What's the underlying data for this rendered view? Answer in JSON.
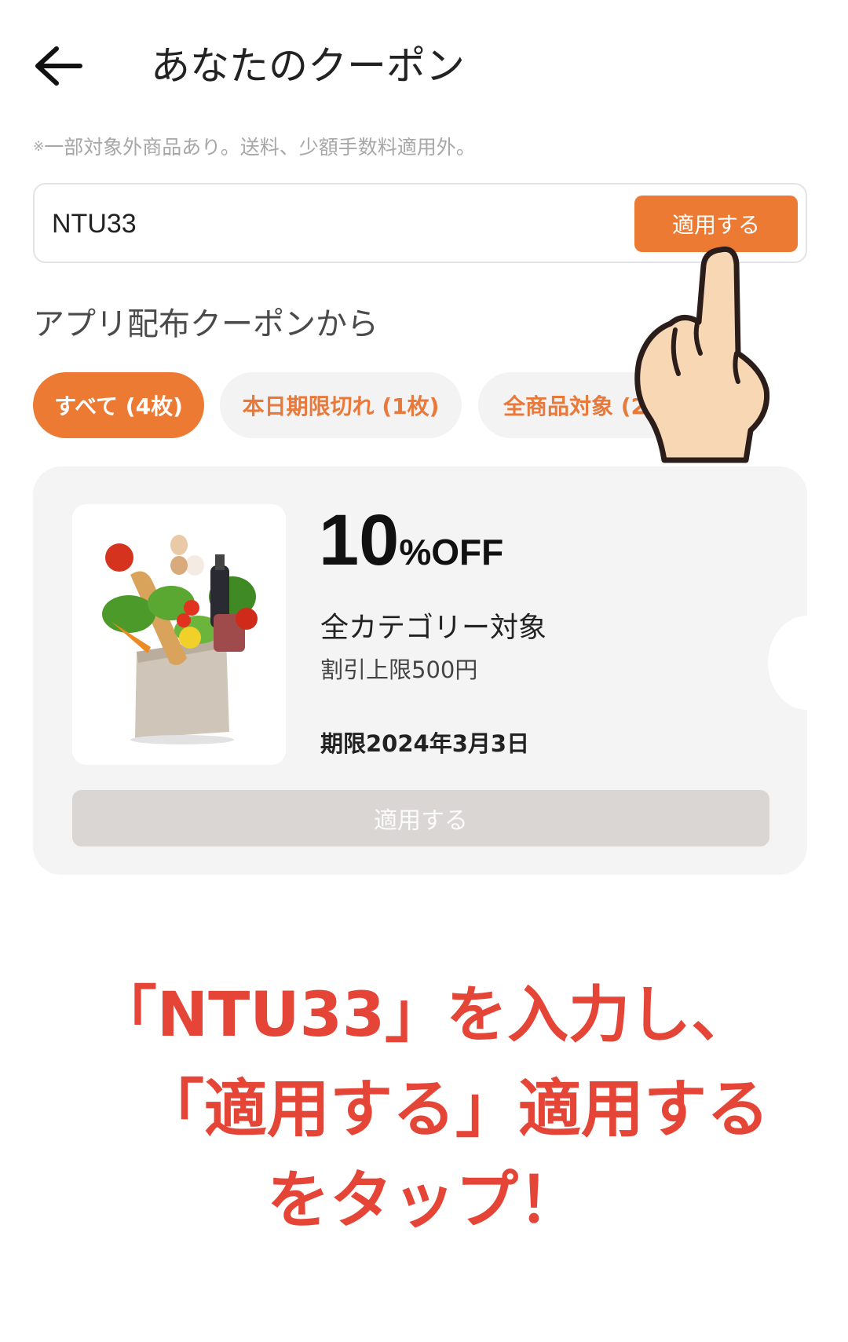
{
  "header": {
    "title": "あなたのクーポン",
    "back_icon": "arrow-left-icon"
  },
  "note": {
    "mark": "※",
    "text": "一部対象外商品あり。送料、少額手数料適用外。"
  },
  "code_entry": {
    "value": "NTU33",
    "apply_label": "適用する"
  },
  "section": {
    "title": "アプリ配布クーポンから"
  },
  "filters": {
    "all": "すべて (4枚)",
    "today": "本日期限切れ (1枚)",
    "product": "全商品対象 (2枚)"
  },
  "coupon": {
    "image": "grocery-bag-image",
    "discount_number": "10",
    "discount_unit": "%OFF",
    "category": "全カテゴリー対象",
    "limit": "割引上限500円",
    "expiry": "期限2024年3月3日",
    "apply_label": "適用する"
  },
  "instructions": {
    "line1": "「NTU33」を入力し、",
    "line2": "「適用する」適用する",
    "line3": "をタップ！"
  },
  "colors": {
    "accent": "#ec7a33",
    "instruction": "#e54537",
    "card_bg": "#f4f4f4",
    "disabled_button": "#d9d6d4"
  }
}
